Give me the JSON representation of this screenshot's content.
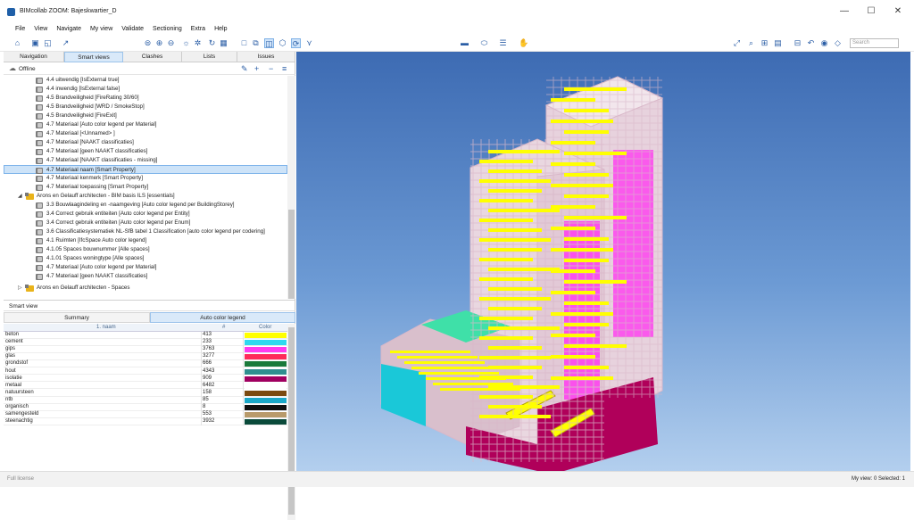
{
  "window": {
    "title": "BIMcollab ZOOM: Bajeskwartier_D",
    "minimize": "—",
    "maximize": "☐",
    "close": "✕"
  },
  "menu": [
    "File",
    "View",
    "Navigate",
    "My view",
    "Validate",
    "Sectioning",
    "Extra",
    "Help"
  ],
  "search": {
    "placeholder": "Search"
  },
  "panel_tabs": [
    "Navigation",
    "Smart views",
    "Clashes",
    "Lists",
    "Issues"
  ],
  "offline_label": "Offline",
  "tree": {
    "rows": [
      "4.4 uitwendig [IsExternal true]",
      "4.4 inwendig [IsExternal false]",
      "4.5 Brandveiligheid [FireRating 30/60]",
      "4.5 Brandveiligheid [WRD / SmokeStop]",
      "4.5 Brandveiligheid [FireExit]",
      "4.7 Materiaal [Auto color legend per Material]",
      "4.7 Materiaal [<Unnamed> ]",
      "4.7 Materiaal [NAAKT classificaties]",
      "4.7 Materiaal [geen NAAKT classificaties]",
      "4.7 Materiaal [NAAKT classificaties - missing]",
      "4.7 Materiaal naam [Smart Property]",
      "4.7 Materiaal kenmerk [Smart Property]",
      "4.7 Materiaal toepassing [Smart Property]"
    ],
    "group2": "Arons en Gelauff architecten - BIM basis ILS [essentials]",
    "group2_rows": [
      "3.3 Bouwlaagindeling en -naamgeving [Auto color legend per BuildingStorey]",
      "3.4 Correct gebruik entiteiten [Auto color legend per Entity]",
      "3.4 Correct gebruik entiteiten [Auto color legend per Enum]",
      "3.6 Classificatiesystematiek NL-SfB tabel 1 Classification [auto color legend per codering]",
      "4.1 Ruimten [IfcSpace Auto color legend]",
      "4.1.05 Spaces bouwnummer [Alle spaces]",
      "4.1.01 Spaces woningtype [Alle spaces]",
      "4.7 Materiaal [Auto color legend per Material]",
      "4.7 Materiaal [geen NAAKT classificaties]"
    ],
    "group3": "Arons en Gelauff architecten - Spaces"
  },
  "smart_view_label": "Smart view",
  "sv_tabs": [
    "Summary",
    "Auto color legend"
  ],
  "legend": {
    "headers": [
      "1. naam",
      "#",
      "Color"
    ],
    "rows": [
      {
        "name": "beton",
        "count": "413",
        "color": "#ffff00"
      },
      {
        "name": "cement",
        "count": "233",
        "color": "#2fd9f0"
      },
      {
        "name": "gips",
        "count": "3763",
        "color": "#ff3cf0"
      },
      {
        "name": "glas",
        "count": "3277",
        "color": "#ff2a5a"
      },
      {
        "name": "grondstof",
        "count": "666",
        "color": "#1a7a3a"
      },
      {
        "name": "hout",
        "count": "4343",
        "color": "#2f8f8f"
      },
      {
        "name": "isolatie",
        "count": "909",
        "color": "#a00060"
      },
      {
        "name": "metaal",
        "count": "6482",
        "color": "#ffffff"
      },
      {
        "name": "natuursteen",
        "count": "158",
        "color": "#7a4a10"
      },
      {
        "name": "ntb",
        "count": "85",
        "color": "#1aa8c8"
      },
      {
        "name": "organisch",
        "count": "8",
        "color": "#101010"
      },
      {
        "name": "samengesteld",
        "count": "553",
        "color": "#b89a6a"
      },
      {
        "name": "steenachtig",
        "count": "3932",
        "color": "#0a4a3a"
      }
    ]
  },
  "status": {
    "license": "Full license",
    "selection": "My view: 0  Selected: 1"
  },
  "model_colors": {
    "frame": "#d9b8c9",
    "slab": "#ffff00",
    "wall": "#ff3cf0",
    "roof": "#3fe0a8",
    "base": "#b0005a",
    "cyan": "#1ac8d8"
  }
}
